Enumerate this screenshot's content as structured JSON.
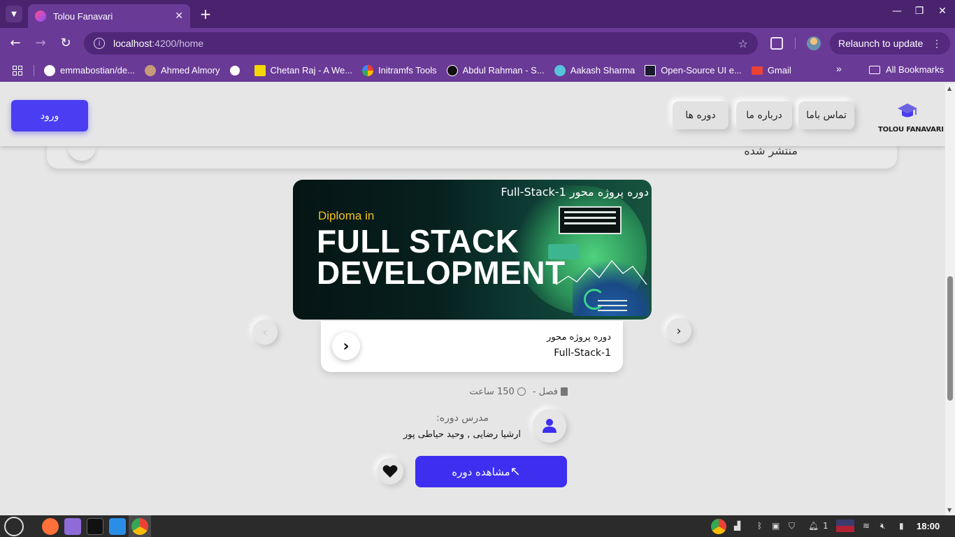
{
  "browser": {
    "tab_title": "Tolou Fanavari",
    "url_host": "localhost",
    "url_path": ":4200/home",
    "relaunch_label": "Relaunch to update",
    "bookmarks": [
      {
        "label": "emmabostian/de...",
        "color": "#ffffff"
      },
      {
        "label": "Ahmed Almory",
        "color": "#c79a7a"
      },
      {
        "label": "",
        "color": "#ffffff"
      },
      {
        "label": "Chetan Raj - A We...",
        "color": "#f5d800"
      },
      {
        "label": "Initramfs Tools",
        "color": "#ffffff"
      },
      {
        "label": "Abdul Rahman - S...",
        "color": "#111111"
      },
      {
        "label": "Aakash Sharma",
        "color": "#58c4dc"
      },
      {
        "label": "Open-Source UI e...",
        "color": "#1a1a2e"
      },
      {
        "label": "Gmail",
        "color": "#ea4335"
      }
    ],
    "all_bookmarks_label": "All Bookmarks"
  },
  "site": {
    "login_label": "ورود",
    "nav": [
      "تماس باما",
      "درباره ما",
      "دوره ها"
    ],
    "logo_text": "TOLOU FANAVARI",
    "accent": "#4a3df2"
  },
  "previous_card": {
    "text": "منتشر شده"
  },
  "course": {
    "banner_title": "دوره پروژه محور Full-Stack-1",
    "banner_diploma": "Diploma in",
    "banner_line1": "FULL STACK",
    "banner_line2": "DEVELOPMENT",
    "card_title": "دوره پروژه محور",
    "card_subtitle": "Full-Stack-1",
    "chapters": "فصل -",
    "hours": "150 ساعت",
    "teacher_label": "مدرس دوره:",
    "teacher_names": "ارشیا رضایی , وحید حیاطی پور",
    "view_label": "مشاهده دوره"
  },
  "taskbar": {
    "clock": "18:00",
    "notification_count": "1"
  }
}
